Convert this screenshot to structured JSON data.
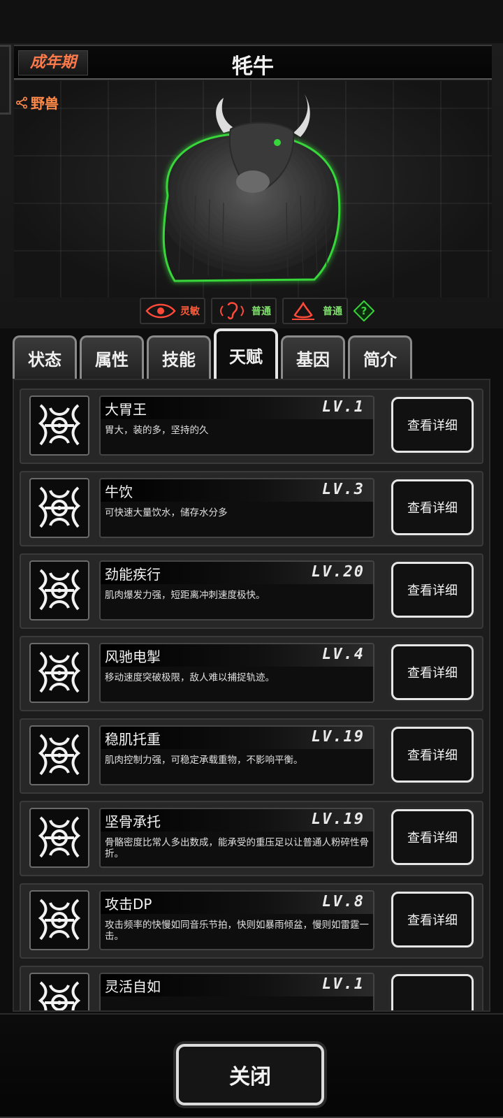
{
  "header": {
    "stage": "成年期",
    "animal_name": "牦牛",
    "category": "野兽"
  },
  "traits": [
    {
      "icon": "eye-icon",
      "label": "灵敏",
      "color": "#ff5a3a"
    },
    {
      "icon": "ear-icon",
      "label": "普通",
      "color": "#7ee06a"
    },
    {
      "icon": "nose-icon",
      "label": "普通",
      "color": "#7ee06a"
    }
  ],
  "tabs": [
    {
      "label": "状态"
    },
    {
      "label": "属性"
    },
    {
      "label": "技能"
    },
    {
      "label": "天赋",
      "active": true
    },
    {
      "label": "基因"
    },
    {
      "label": "简介"
    }
  ],
  "talents": [
    {
      "name": "大胃王",
      "level": "LV.1",
      "desc": "胃大，装的多，坚持的久",
      "button": "查看详细"
    },
    {
      "name": "牛饮",
      "level": "LV.3",
      "desc": "可快速大量饮水，储存水分多",
      "button": "查看详细"
    },
    {
      "name": "劲能疾行",
      "level": "LV.20",
      "desc": "肌肉爆发力强，短距离冲刺速度极快。",
      "button": "查看详细"
    },
    {
      "name": "风驰电掣",
      "level": "LV.4",
      "desc": "移动速度突破极限，敌人难以捕捉轨迹。",
      "button": "查看详细"
    },
    {
      "name": "稳肌托重",
      "level": "LV.19",
      "desc": "肌肉控制力强，可稳定承载重物，不影响平衡。",
      "button": "查看详细"
    },
    {
      "name": "坚骨承托",
      "level": "LV.19",
      "desc": "骨骼密度比常人多出数成，能承受的重压足以让普通人粉碎性骨折。",
      "button": "查看详细"
    },
    {
      "name": "攻击DP",
      "level": "LV.8",
      "desc": "攻击频率的快慢如同音乐节拍，快则如暴雨倾盆，慢则如雷霆一击。",
      "button": "查看详细"
    },
    {
      "name": "灵活自如",
      "level": "LV.1",
      "desc": "",
      "button": ""
    }
  ],
  "footer": {
    "close_label": "关闭"
  }
}
